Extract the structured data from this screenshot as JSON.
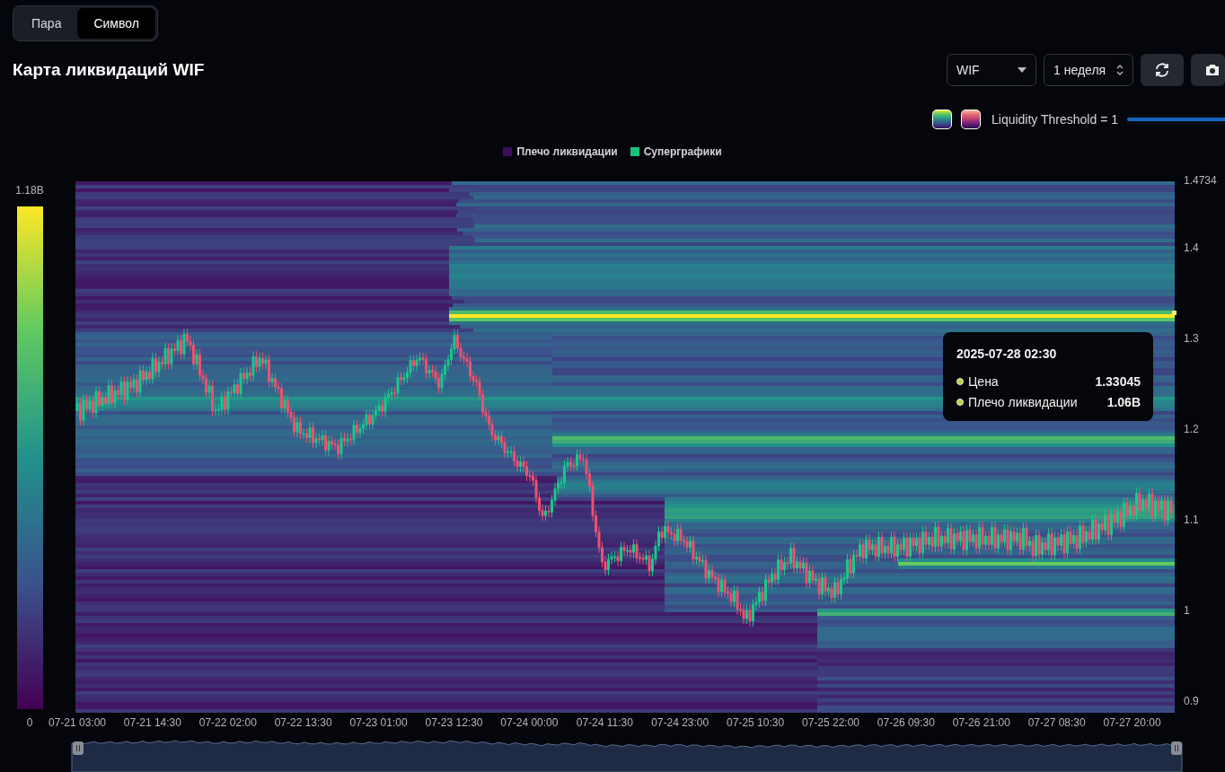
{
  "mode_tabs": [
    {
      "label": "Пара",
      "selected": false
    },
    {
      "label": "Символ",
      "selected": true
    }
  ],
  "title": "Карта ликвидаций WIF",
  "symbol_select": {
    "value": "WIF"
  },
  "period_select": {
    "value": "1 неделя"
  },
  "threshold": {
    "label": "Liquidity Threshold = 1",
    "level": 1
  },
  "legend": [
    {
      "label": "Плечо ликвидации",
      "color": "#3e0d5c"
    },
    {
      "label": "Суперграфики",
      "color": "#19c17f"
    }
  ],
  "color_scale": {
    "max": "1.18B",
    "min": "0"
  },
  "price_axis": [
    "1.4734",
    "1.4",
    "1.3",
    "1.2",
    "1.1",
    "1",
    "0.9"
  ],
  "time_axis": [
    "07-21 03:00",
    "07-21 14:30",
    "07-22 02:00",
    "07-22 13:30",
    "07-23 01:00",
    "07-23 12:30",
    "07-24 00:00",
    "07-24 11:30",
    "07-24 23:00",
    "07-25 10:30",
    "07-25 22:00",
    "07-26 09:30",
    "07-26 21:00",
    "07-27 08:30",
    "07-27 20:00"
  ],
  "tooltip": {
    "time": "2025-07-28 02:30",
    "rows": [
      {
        "label": "Цена",
        "value": "1.33045"
      },
      {
        "label": "Плечо ликвидации",
        "value": "1.06B"
      }
    ]
  }
}
